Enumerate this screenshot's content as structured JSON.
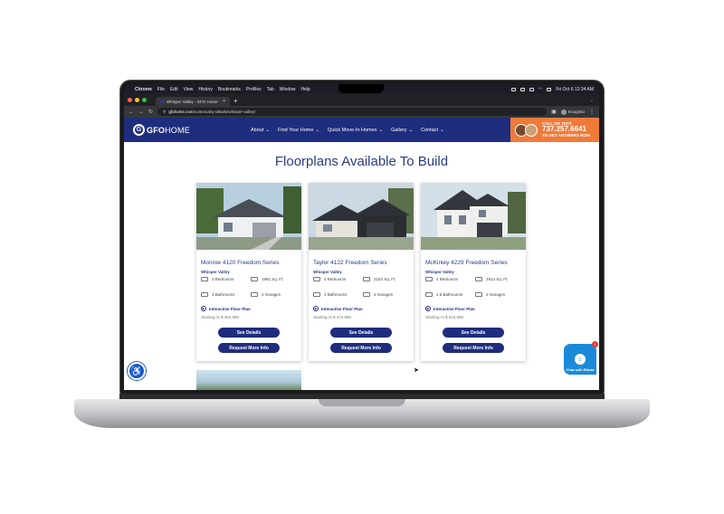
{
  "menubar": {
    "app": "Chrome",
    "items": [
      "File",
      "Edit",
      "View",
      "History",
      "Bookmarks",
      "Profiles",
      "Tab",
      "Window",
      "Help"
    ],
    "datetime": "Fri Oct 6  12:34 AM"
  },
  "browser": {
    "tab_title": "Whisper Valley - GFO Home",
    "url_host": "gfohome.com",
    "url_path": "/community-details/whisper-valley/",
    "incognito_label": "Incognito"
  },
  "site": {
    "logo_mark": "G",
    "logo_bold": "GFO",
    "logo_rest": "HOME",
    "nav": [
      {
        "label": "About"
      },
      {
        "label": "Find Your Home"
      },
      {
        "label": "Quick Move-In Homes"
      },
      {
        "label": "Gallery"
      },
      {
        "label": "Contact"
      }
    ],
    "call": {
      "line1": "CALL OR TEXT",
      "phone": "737.257.6641",
      "line3": "TO GET ANSWERS NOW"
    },
    "heading": "Floorplans Available To Build",
    "cards": [
      {
        "title": "Monroe 4120 Freedom Series",
        "community": "Whisper Valley",
        "bedrooms": "3 Bedrooms",
        "sqft": "1991 Sq. Ft.",
        "bathrooms": "2 Bathrooms",
        "garages": "2 Garages",
        "floor_plan": "Interactive Floor Plan",
        "price": "Starting At $ 484,990",
        "details_btn": "See Details",
        "request_btn": "Request More Info"
      },
      {
        "title": "Taylor 4122 Freedom Series",
        "community": "Whisper Valley",
        "bedrooms": "4 Bedrooms",
        "sqft": "2153 Sq. Ft.",
        "bathrooms": "2 Bathrooms",
        "garages": "2 Garages",
        "floor_plan": "Interactive Floor Plan",
        "price": "Starting At $ 474,990",
        "details_btn": "See Details",
        "request_btn": "Request More Info"
      },
      {
        "title": "McKinley 4229 Freedom Series",
        "community": "Whisper Valley",
        "bedrooms": "4 Bedrooms",
        "sqft": "2914 Sq. Ft.",
        "bathrooms": "2.5 Bathrooms",
        "garages": "2 Garages",
        "floor_plan": "Interactive Floor Plan",
        "price": "Starting At $ 534,990",
        "details_btn": "See Details",
        "request_btn": "Request More Info"
      }
    ],
    "chat": {
      "label": "Chat with Eliana",
      "badge": "1"
    },
    "colors": {
      "brand_navy": "#1e2d7d",
      "accent_orange": "#ef7b3a",
      "chat_blue": "#1a8ad8"
    }
  }
}
